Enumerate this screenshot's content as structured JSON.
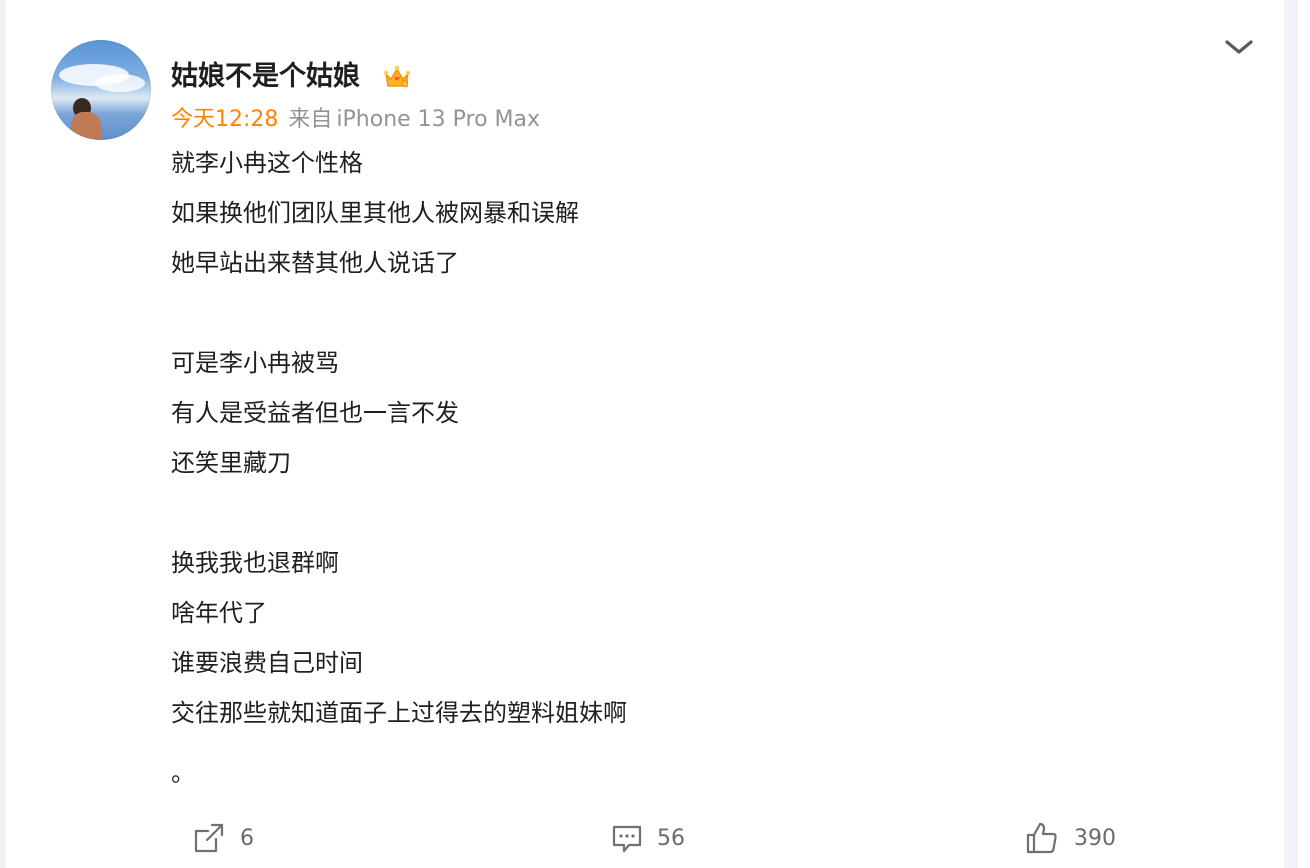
{
  "post": {
    "username": "姑娘不是个姑娘",
    "time": "今天12:28",
    "source_prefix": "来自",
    "device": "iPhone 13 Pro Max",
    "lines": [
      "就李小冉这个性格",
      "如果换他们团队里其他人被网暴和误解",
      "她早站出来替其他人说话了",
      "",
      "可是李小冉被骂",
      "有人是受益者但也一言不发",
      "还笑里藏刀",
      "",
      "换我我也退群啊",
      "啥年代了",
      "谁要浪费自己时间",
      "交往那些就知道面子上过得去的塑料姐妹啊"
    ],
    "trailing_mark": "。"
  },
  "actions": {
    "share_count": "6",
    "comment_count": "56",
    "like_count": "390"
  },
  "icons": {
    "avatar": "avatar-photo",
    "badge": "crown-badge-icon",
    "menu": "chevron-down-icon",
    "share": "share-icon",
    "comment": "comment-icon",
    "like": "thumbs-up-icon"
  },
  "colors": {
    "time": "#ff8200",
    "meta_gray": "#939393",
    "text": "#1f1f1f",
    "action_gray": "#6b6b6b"
  }
}
